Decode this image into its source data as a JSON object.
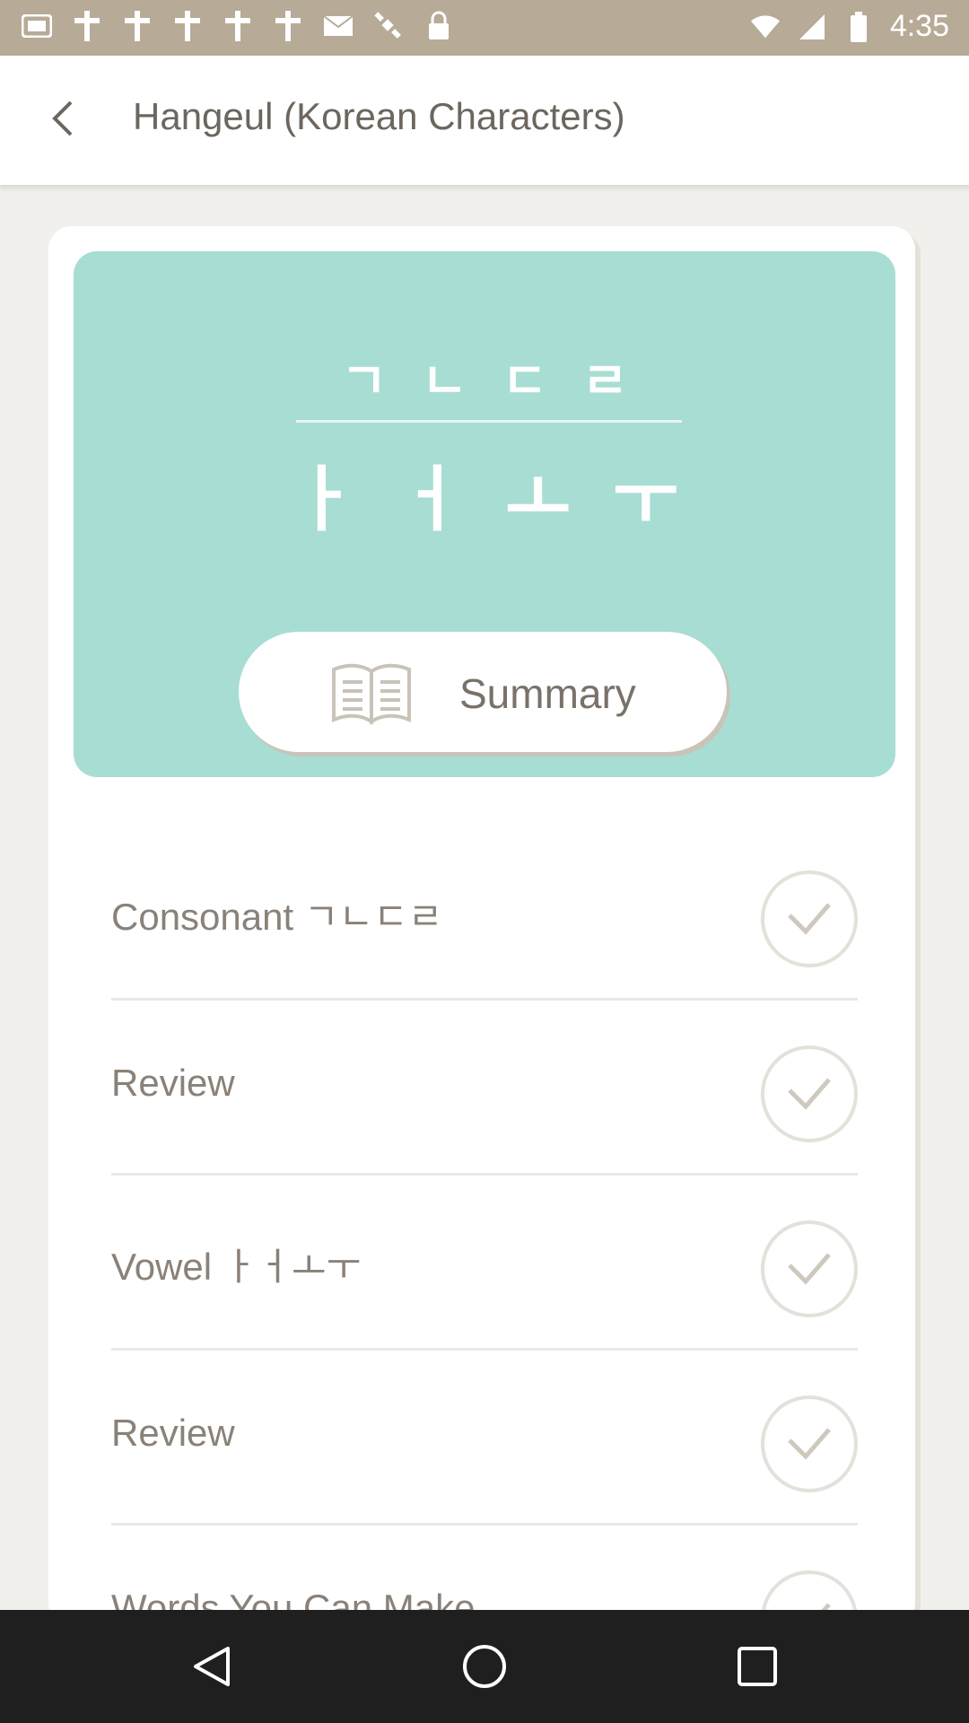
{
  "status_bar": {
    "time": "4:35",
    "icons": [
      "photos-icon",
      "cross-icon",
      "cross-icon",
      "cross-icon",
      "cross-icon",
      "cross-icon",
      "mail-icon",
      "satellite-icon",
      "lock-icon",
      "wifi-icon",
      "signal-icon",
      "battery-icon"
    ],
    "color": "#b7aa97"
  },
  "app_bar": {
    "title": "Hangeul (Korean Characters)"
  },
  "hero": {
    "consonants": "ㄱㄴㄷㄹ",
    "vowels": "ㅏㅓㅗㅜ",
    "summary_label": "Summary",
    "color": "#a8ddd4"
  },
  "lessons": [
    {
      "label": "Consonant ㄱㄴㄷㄹ"
    },
    {
      "label": "Review"
    },
    {
      "label": "Vowel ㅏㅓㅗㅜ"
    },
    {
      "label": "Review"
    },
    {
      "label": "Words You Can Make"
    }
  ],
  "nav_bar": {
    "buttons": [
      "back-nav-icon",
      "home-nav-icon",
      "recents-nav-icon"
    ]
  }
}
